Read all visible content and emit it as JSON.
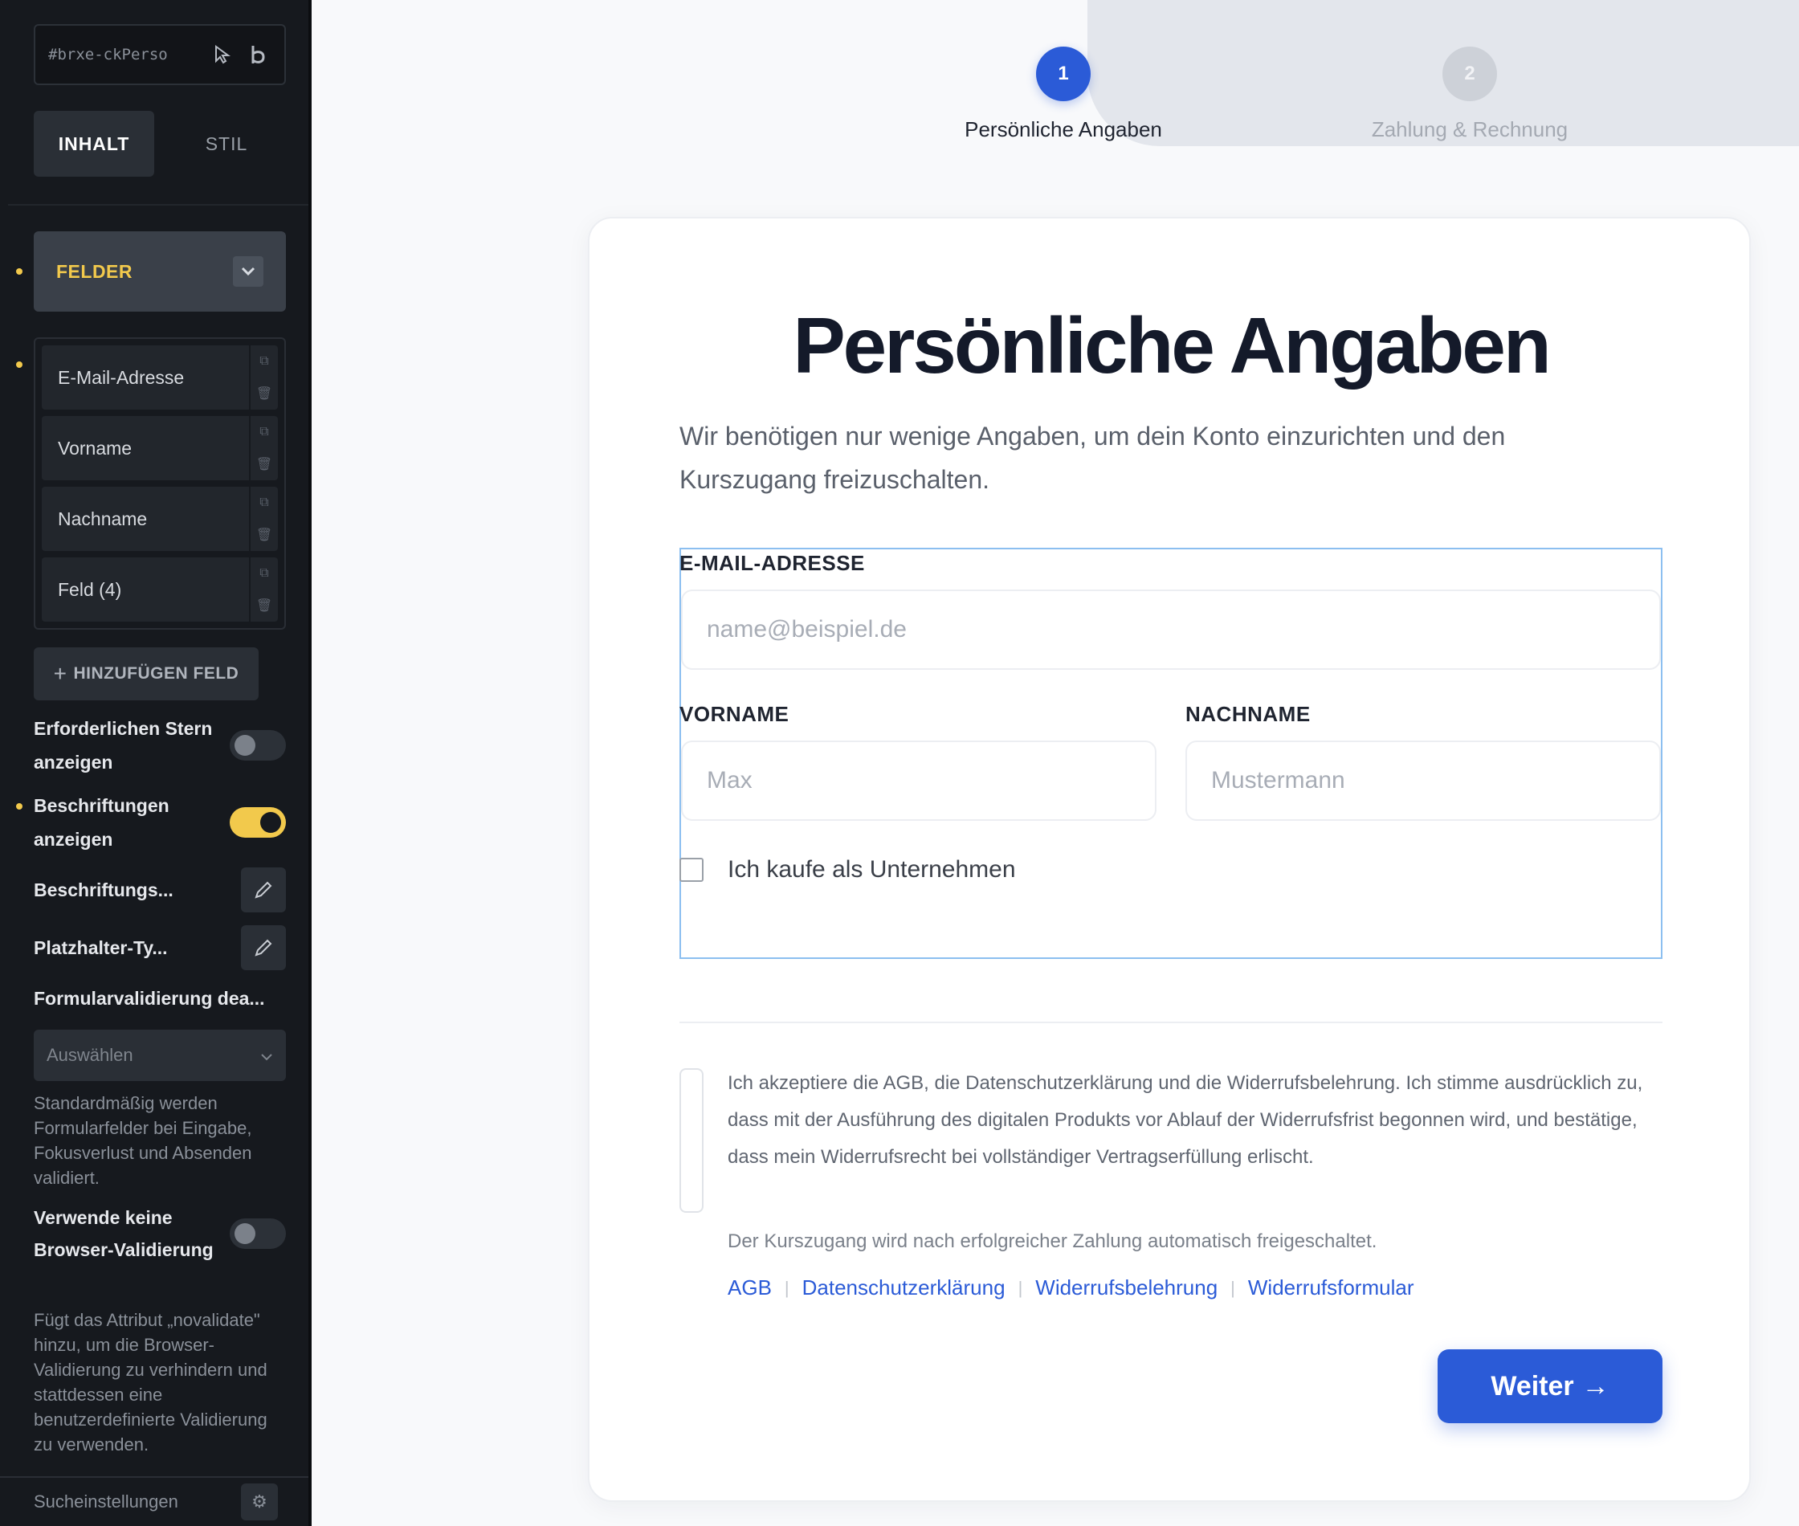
{
  "sidebar": {
    "selector_text": "#brxe-ckPerso",
    "selector_icons": [
      "cursor-icon",
      "bold-icon"
    ],
    "tabs": [
      {
        "label": "INHALT",
        "active": true
      },
      {
        "label": "STIL",
        "active": false
      }
    ],
    "group_label": "FELDER",
    "fields": [
      {
        "label": "E-Mail-Adresse"
      },
      {
        "label": "Vorname"
      },
      {
        "label": "Nachname"
      },
      {
        "label": "Feld (4)"
      }
    ],
    "add_field_label": "HINZUFÜGEN FELD",
    "required_star_label": "Erforderlichen Stern anzeigen",
    "required_star_on": false,
    "show_labels_label": "Beschriftungen anzeigen",
    "show_labels_on": true,
    "label_type_label": "Beschriftungs...",
    "placeholder_type_label": "Platzhalter-Ty...",
    "validation_label": "Formularvalidierung dea...",
    "validation_select": "Auswählen",
    "validation_help": "Standardmäßig werden Formularfelder bei Eingabe, Fokusverlust und Absenden validiert.",
    "no_browser_validation_label": "Verwende keine Browser-Validierung",
    "no_browser_validation_on": false,
    "novalidate_help": "Fügt das Attribut „novalidate\" hinzu, um die Browser-Validierung zu verhindern und stattdessen eine benutzerdefinierte Validierung zu verwenden.",
    "footer_label": "Sucheinstellungen"
  },
  "stepper": [
    {
      "number": "1",
      "label": "Persönliche Angaben",
      "active": true
    },
    {
      "number": "2",
      "label": "Zahlung & Rechnung",
      "active": false
    }
  ],
  "form": {
    "title": "Persönliche Angaben",
    "subtitle": "Wir benötigen nur wenige Angaben, um dein Konto einzurichten und den Kurszugang freizuschalten.",
    "email_label": "E-MAIL-ADRESSE",
    "email_placeholder": "name@beispiel.de",
    "firstname_label": "VORNAME",
    "firstname_placeholder": "Max",
    "lastname_label": "NACHNAME",
    "lastname_placeholder": "Mustermann",
    "company_checkbox_label": "Ich kaufe als Unternehmen",
    "company_checked": false,
    "legal_text": "Ich akzeptiere die AGB, die Datenschutzerklärung und die Widerrufsbelehrung. Ich stimme ausdrücklich zu, dass mit der Ausführung des digitalen Produkts vor Ablauf der Widerrufsfrist begonnen wird, und bestätige, dass mein Widerrufsrecht bei vollständiger Vertragserfüllung erlischt.",
    "legal_checked": false,
    "access_note": "Der Kurszugang wird nach erfolgreicher Zahlung automatisch freigeschaltet.",
    "links": [
      {
        "label": "AGB"
      },
      {
        "label": "Datenschutzerklärung"
      },
      {
        "label": "Widerrufsbelehrung"
      },
      {
        "label": "Widerrufsformular"
      }
    ],
    "next_button": "Weiter",
    "next_arrow": "→"
  },
  "colors": {
    "accent": "#2b5bd7",
    "sidebar_bg": "#16191e",
    "highlight_yellow": "#f2c94c"
  }
}
